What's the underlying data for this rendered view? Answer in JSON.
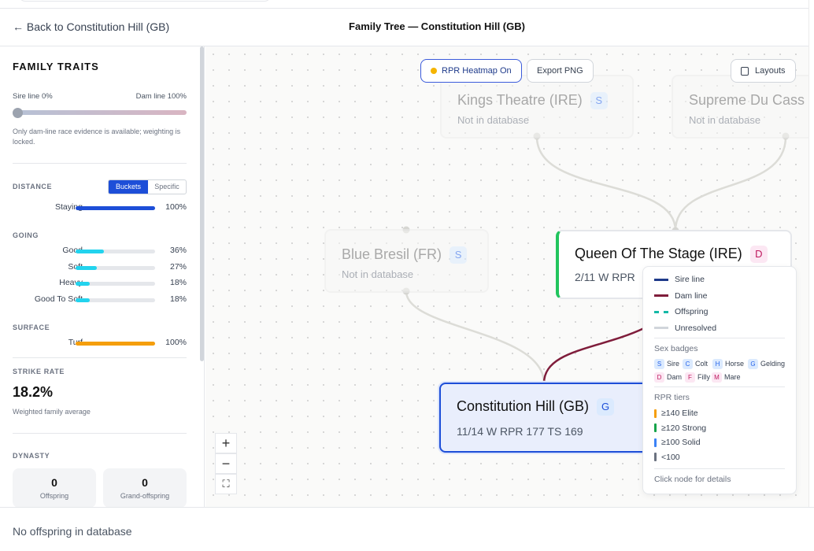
{
  "header": {
    "back_label": "← Back to Constitution Hill (GB)",
    "title": "Family Tree — Constitution Hill (GB)"
  },
  "sidebar": {
    "title": "FAMILY TRAITS",
    "slider": {
      "left_label": "Sire line 0%",
      "right_label": "Dam line 100%",
      "value": 1.0,
      "note": "Only dam-line race evidence is available; weighting is locked."
    },
    "distance": {
      "label": "DISTANCE",
      "toggle": [
        "Buckets",
        "Specific"
      ],
      "active": "Buckets",
      "rows": [
        {
          "label": "Staying",
          "pct": "100%",
          "value": 100,
          "color": "#1d4ed8"
        }
      ]
    },
    "going": {
      "label": "GOING",
      "rows": [
        {
          "label": "Good",
          "pct": "36%",
          "value": 36,
          "color": "#22d3ee"
        },
        {
          "label": "Soft",
          "pct": "27%",
          "value": 27,
          "color": "#22d3ee"
        },
        {
          "label": "Heavy",
          "pct": "18%",
          "value": 18,
          "color": "#22d3ee"
        },
        {
          "label": "Good To Soft",
          "pct": "18%",
          "value": 18,
          "color": "#22d3ee"
        }
      ]
    },
    "surface": {
      "label": "SURFACE",
      "rows": [
        {
          "label": "Turf",
          "pct": "100%",
          "value": 100,
          "color": "#f59e0b"
        }
      ]
    },
    "strike": {
      "label": "STRIKE RATE",
      "value": "18.2%",
      "note": "Weighted family average"
    },
    "dynasty": {
      "label": "DYNASTY",
      "cards": [
        {
          "n": "0",
          "c": "Offspring"
        },
        {
          "n": "0",
          "c": "Grand-offspring"
        }
      ]
    }
  },
  "toolbar": {
    "heatmap": "RPR Heatmap On",
    "export": "Export PNG",
    "layouts": "Layouts"
  },
  "nodes": {
    "kings": {
      "name": "Kings Theatre (IRE)",
      "badge": "S",
      "sub": "Not in database"
    },
    "supreme": {
      "name": "Supreme Du Cass",
      "badge": "",
      "sub": "Not in database"
    },
    "blue": {
      "name": "Blue Bresil (FR)",
      "badge": "S",
      "sub": "Not in database"
    },
    "queen": {
      "name": "Queen Of The Stage (IRE)",
      "badge": "D",
      "sub": "2/11 W   RPR"
    },
    "hill": {
      "name": "Constitution Hill (GB)",
      "badge": "G",
      "sub": "11/14 W   RPR 177   TS 169"
    }
  },
  "legend": {
    "lines": [
      {
        "label": "Sire line",
        "color": "#1e3a8a"
      },
      {
        "label": "Dam line",
        "color": "#7f1d3b"
      },
      {
        "label": "Offspring",
        "color": "#14b8a6"
      },
      {
        "label": "Unresolved",
        "color": "#d1d5db"
      }
    ],
    "sex_title": "Sex badges",
    "sex": [
      {
        "k": "S",
        "v": "Sire"
      },
      {
        "k": "C",
        "v": "Colt"
      },
      {
        "k": "H",
        "v": "Horse"
      },
      {
        "k": "G",
        "v": "Gelding"
      },
      {
        "k": "D",
        "v": "Dam"
      },
      {
        "k": "F",
        "v": "Filly"
      },
      {
        "k": "M",
        "v": "Mare"
      }
    ],
    "tier_title": "RPR tiers",
    "tiers": [
      {
        "label": "≥140 Elite",
        "color": "#f59e0b"
      },
      {
        "label": "≥120 Strong",
        "color": "#16a34a"
      },
      {
        "label": "≥100 Solid",
        "color": "#3b82f6"
      },
      {
        "label": "<100",
        "color": "#6b7280"
      }
    ],
    "hint": "Click node for details"
  },
  "zoom": {
    "in": "+",
    "out": "−",
    "fit": "⛶"
  },
  "footer": {
    "text": "No offspring in database"
  }
}
